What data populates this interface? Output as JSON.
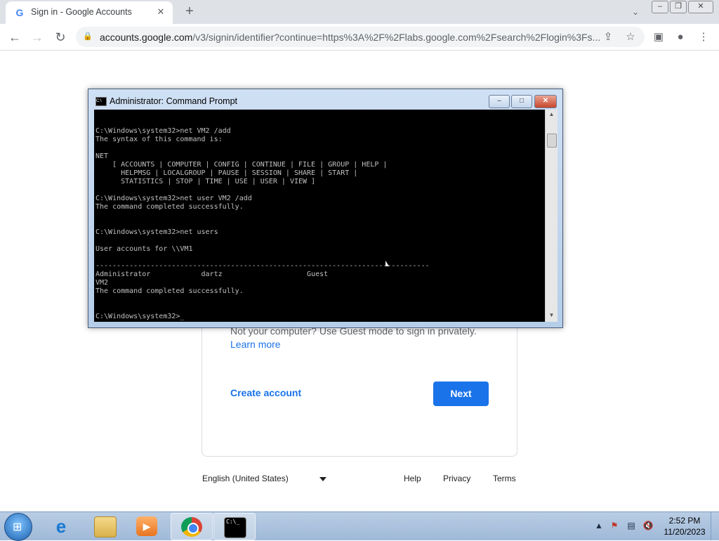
{
  "browser": {
    "tab_title": "Sign in - Google Accounts",
    "tab_icon": "G",
    "url_host": "accounts.google.com",
    "url_rest": "/v3/signin/identifier?continue=https%3A%2F%2Flabs.google.com%2Fsearch%2Flogin%3Fs..."
  },
  "page": {
    "guest_text": "Not your computer? Use Guest mode to sign in privately.",
    "learn_more": "Learn more",
    "create_account": "Create account",
    "next": "Next",
    "language": "English (United States)",
    "footer": {
      "help": "Help",
      "privacy": "Privacy",
      "terms": "Terms"
    }
  },
  "cmd": {
    "title": "Administrator:  Command Prompt",
    "output": "C:\\Windows\\system32>net VM2 /add\nThe syntax of this command is:\n\nNET\n    [ ACCOUNTS | COMPUTER | CONFIG | CONTINUE | FILE | GROUP | HELP |\n      HELPMSG | LOCALGROUP | PAUSE | SESSION | SHARE | START |\n      STATISTICS | STOP | TIME | USE | USER | VIEW ]\n\nC:\\Windows\\system32>net user VM2 /add\nThe command completed successfully.\n\n\nC:\\Windows\\system32>net users\n\nUser accounts for \\\\VM1\n\n-------------------------------------------------------------------------------\nAdministrator            dartz                    Guest\nVM2\nThe command completed successfully.\n\n\nC:\\Windows\\system32>_"
  },
  "taskbar": {
    "time": "2:52 PM",
    "date": "11/20/2023"
  },
  "colors": {
    "accent": "#1a73e8",
    "console_bg": "#000000",
    "console_fg": "#c0c0c0"
  }
}
